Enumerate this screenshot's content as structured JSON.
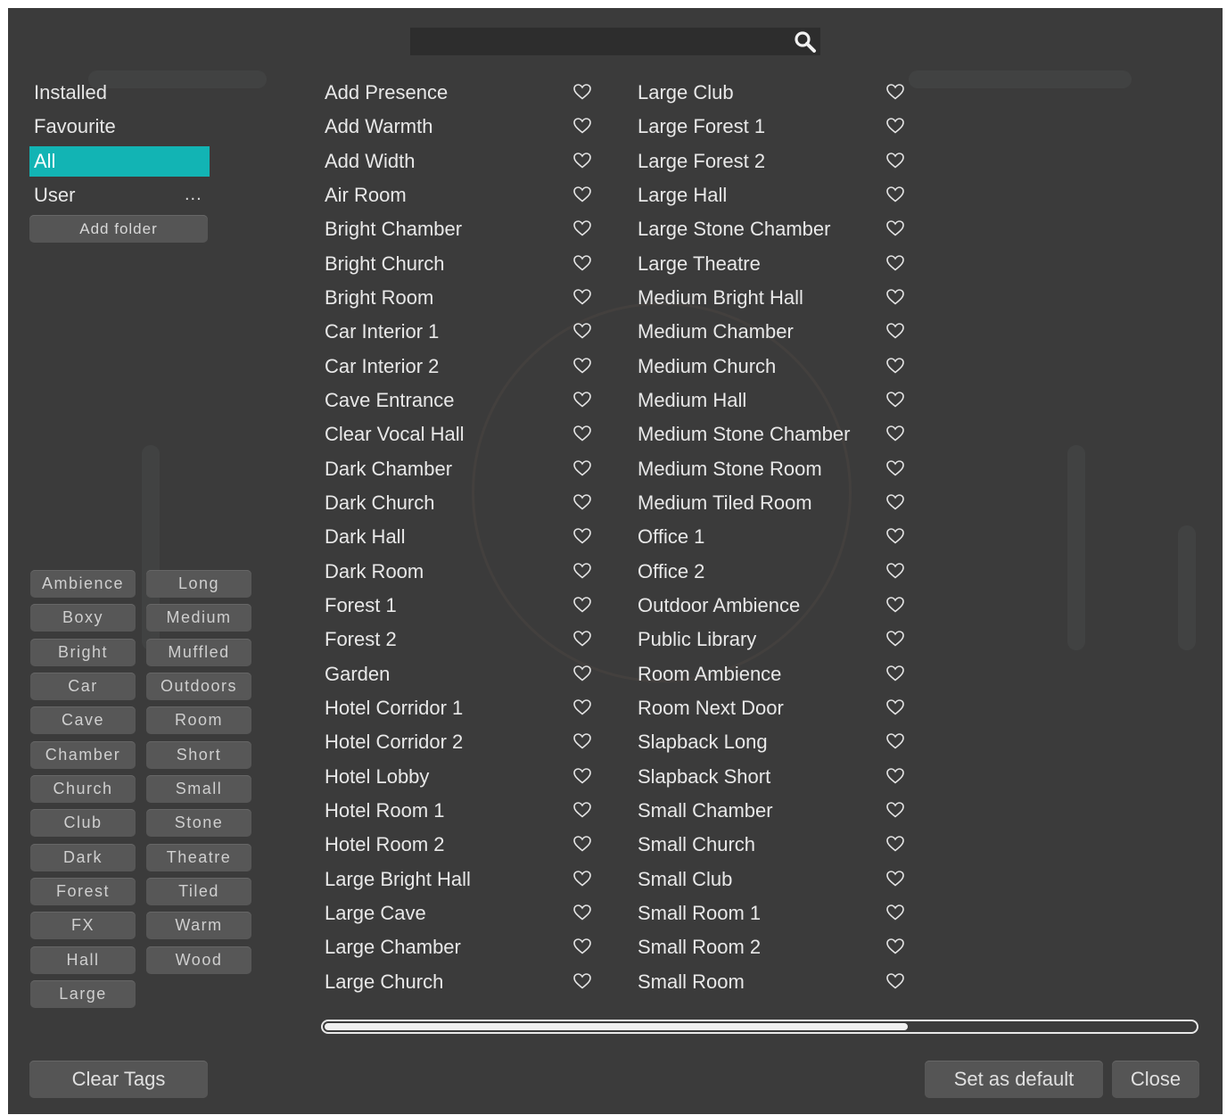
{
  "search": {
    "placeholder": "",
    "value": ""
  },
  "categories": [
    {
      "label": "Installed",
      "selected": false
    },
    {
      "label": "Favourite",
      "selected": false
    },
    {
      "label": "All",
      "selected": true
    },
    {
      "label": "User",
      "selected": false
    }
  ],
  "user_more": "...",
  "add_folder_label": "Add folder",
  "tags": [
    [
      "Ambience",
      "Long"
    ],
    [
      "Boxy",
      "Medium"
    ],
    [
      "Bright",
      "Muffled"
    ],
    [
      "Car",
      "Outdoors"
    ],
    [
      "Cave",
      "Room"
    ],
    [
      "Chamber",
      "Short"
    ],
    [
      "Church",
      "Small"
    ],
    [
      "Club",
      "Stone"
    ],
    [
      "Dark",
      "Theatre"
    ],
    [
      "Forest",
      "Tiled"
    ],
    [
      "FX",
      "Warm"
    ],
    [
      "Hall",
      "Wood"
    ],
    [
      "Large"
    ]
  ],
  "presets_col1": [
    "Add Presence",
    "Add Warmth",
    "Add Width",
    "Air Room",
    "Bright Chamber",
    "Bright Church",
    "Bright Room",
    "Car Interior 1",
    "Car Interior 2",
    "Cave Entrance",
    "Clear Vocal Hall",
    "Dark Chamber",
    "Dark Church",
    "Dark Hall",
    "Dark Room",
    "Forest 1",
    "Forest 2",
    "Garden",
    "Hotel Corridor 1",
    "Hotel Corridor 2",
    "Hotel Lobby",
    "Hotel Room 1",
    "Hotel Room 2",
    "Large Bright Hall",
    "Large Cave",
    "Large Chamber",
    "Large Church"
  ],
  "presets_col2": [
    "Large Club",
    "Large Forest 1",
    "Large Forest 2",
    "Large Hall",
    "Large Stone Chamber",
    "Large Theatre",
    "Medium Bright Hall",
    "Medium Chamber",
    "Medium Church",
    "Medium Hall",
    "Medium Stone Chamber",
    "Medium Stone Room",
    "Medium Tiled Room",
    "Office 1",
    "Office 2",
    "Outdoor Ambience",
    "Public Library",
    "Room Ambience",
    "Room Next Door",
    "Slapback Long",
    "Slapback Short",
    "Small Chamber",
    "Small Church",
    "Small Club",
    "Small Room 1",
    "Small Room 2",
    "Small Room"
  ],
  "icons": {
    "search": "search-icon",
    "favourite": "heart-outline-icon"
  },
  "scroll": {
    "position_fraction": 0.67
  },
  "buttons": {
    "clear_tags": "Clear Tags",
    "set_default": "Set as default",
    "close": "Close"
  },
  "colors": {
    "selected": "#12b4b4",
    "panel_bg": "#3b3b3b",
    "button_bg": "#555555"
  }
}
